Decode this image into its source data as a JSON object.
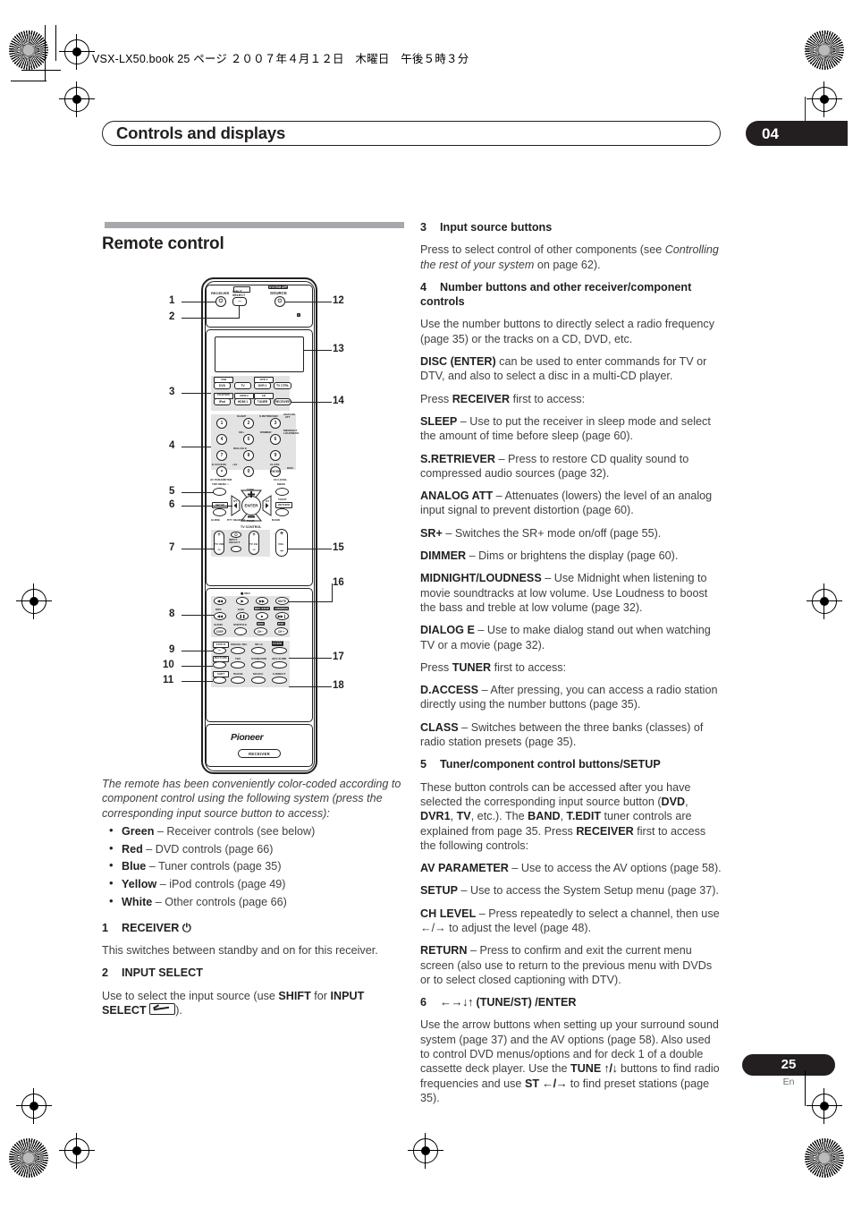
{
  "printmark": {
    "book_line": "VSX-LX50.book  25 ページ  ２００７年４月１２日　木曜日　午後５時３分"
  },
  "header": {
    "chapter_title": "Controls and displays",
    "chapter_number": "04"
  },
  "section": {
    "heading": "Remote control"
  },
  "footer": {
    "page_number": "25",
    "language": "En"
  },
  "left_column": {
    "caption": "The remote has been conveniently color-coded according to component control using the following system (press the corresponding input source button to access):",
    "color_bullets": [
      {
        "color": "Green",
        "text": " – Receiver controls (see below)"
      },
      {
        "color": "Red",
        "text": " – DVD controls (page 66)"
      },
      {
        "color": "Blue",
        "text": " – Tuner controls (page 35)"
      },
      {
        "color": "Yellow",
        "text": " – iPod controls (page 49)"
      },
      {
        "color": "White",
        "text": " – Other controls (page 66)"
      }
    ],
    "item1": {
      "num": "1",
      "title": "RECEIVER",
      "body": "This switches between standby and on for this receiver."
    },
    "item2": {
      "num": "2",
      "title": "INPUT SELECT",
      "body_a": "Use to select the input source (use ",
      "bold_a": "SHIFT",
      "body_b": " for ",
      "bold_b": "INPUT SELECT",
      "body_c": ")."
    }
  },
  "right_column": {
    "item3": {
      "num": "3",
      "title": "Input source buttons",
      "body_a": "Press to select control of other components (see ",
      "italic": "Controlling the rest of your system",
      "body_b": " on page 62)."
    },
    "item4": {
      "num": "4",
      "title": "Number buttons and other receiver/component controls",
      "body": "Use the number buttons to directly select a radio frequency (page 35) or the tracks on a CD, DVD, etc.",
      "disc_bold": "DISC (ENTER)",
      "disc_text": " can be used to enter commands for TV or DTV, and also to select a disc in a multi-CD player.",
      "press_a": "Press ",
      "press_bold": "RECEIVER",
      "press_b": " first to access:",
      "entries": [
        {
          "term": "SLEEP",
          "desc": " – Use to put the receiver in sleep mode and select the amount of time before sleep (page 60)."
        },
        {
          "term": "S.RETRIEVER",
          "desc": " – Press to restore CD quality sound to compressed audio sources (page 32)."
        },
        {
          "term": "ANALOG ATT",
          "desc": " – Attenuates (lowers) the level of an analog input signal to prevent distortion (page 60)."
        },
        {
          "term": "SR+",
          "desc": " – Switches the SR+ mode on/off (page 55)."
        },
        {
          "term": "DIMMER",
          "desc": " – Dims or brightens the display (page 60)."
        },
        {
          "term": "MIDNIGHT/LOUDNESS",
          "desc": " – Use Midnight when listening to movie soundtracks at low volume. Use Loudness to boost the bass and treble at low volume (page 32)."
        },
        {
          "term": "DIALOG E",
          "desc": " – Use to make dialog stand out when watching TV or a movie (page 32)."
        }
      ],
      "press2_a": "Press ",
      "press2_bold": "TUNER",
      "press2_b": " first to access:",
      "entries2": [
        {
          "term": "D.ACCESS",
          "desc": " – After pressing, you can access a radio station directly using the number buttons (page 35)."
        },
        {
          "term": "CLASS",
          "desc": " – Switches between the three banks (classes) of radio station presets (page 35)."
        }
      ]
    },
    "item5": {
      "num": "5",
      "title": "Tuner/component control buttons/SETUP",
      "body_a": "These button controls can be accessed after you have selected the corresponding input source button (",
      "b1": "DVD",
      "body_b": ", ",
      "b2": "DVR1",
      "body_c": ", ",
      "b3": "TV",
      "body_d": ", etc.). The ",
      "b4": "BAND",
      "body_e": ", ",
      "b5": "T.EDIT",
      "body_f": " tuner controls are explained from page 35. Press ",
      "b6": "RECEIVER",
      "body_g": " first to access the following controls:",
      "entries": [
        {
          "term": "AV PARAMETER",
          "desc": " – Use to access the AV options (page 58)."
        },
        {
          "term": "SETUP",
          "desc": " – Use to access the System Setup menu (page 37)."
        },
        {
          "term": "CH LEVEL",
          "desc": " – Press repeatedly to select a channel, then use ←/→ to adjust the level (page 48)."
        },
        {
          "term": "RETURN",
          "desc": " – Press to confirm and exit the current menu screen (also use to return to the previous menu with DVDs or to select closed captioning with DTV)."
        }
      ]
    },
    "item6": {
      "num": "6",
      "title_arrows": "←→↓↑",
      "title_rest": " (TUNE/ST) /ENTER",
      "body_a": "Use the arrow buttons when setting up your surround sound system (page 37) and the AV options (page 58). Also used to control DVD menus/options and for deck 1 of a double cassette deck player. Use the ",
      "b1": "TUNE",
      "b1_arrows": " ↑/↓",
      "body_b": " buttons to find radio frequencies and use ",
      "b2": "ST",
      "b2_arrows": " ←/→",
      "body_c": " to find preset stations (page 35)."
    }
  },
  "remote": {
    "callouts_left": [
      "1",
      "2",
      "3",
      "4",
      "5",
      "6",
      "7",
      "8",
      "9",
      "10",
      "11"
    ],
    "callouts_right": [
      "12",
      "13",
      "14",
      "15",
      "16",
      "17",
      "18"
    ],
    "top_labels": {
      "receiver": "RECEIVER",
      "input_select": "INPUT\nSELECT",
      "system_off": "SYSTEM OFF",
      "source": "SOURCE"
    },
    "source_buttons_row1": [
      "DVD",
      "TV",
      "DVR 1",
      "TV CTRL"
    ],
    "source_buttons_row2": [
      "iPod",
      "HDMI 1",
      "TUNER",
      "RECEIVER"
    ],
    "source_shift_row1": [
      "USB",
      "DVR 2"
    ],
    "source_shift_row2": [
      "CD-R/TAPE",
      "HDMI 2",
      "CD"
    ],
    "numpad": [
      "1",
      "2",
      "3",
      "4",
      "5",
      "6",
      "7",
      "8",
      "9",
      "∙",
      "0",
      "ENTER"
    ],
    "numpad_shift": [
      "SLEEP",
      "S.RETRIEVER",
      "ANALOG ATT",
      "SR+",
      "DIMMER",
      "MIDNIGHT/ LOUDNESS",
      "DIALOG E",
      "D.ACCESS",
      "+10",
      "CLASS",
      "DISC"
    ],
    "nav_labels": {
      "av_parameter": "AV PARAMETER",
      "top_menu": "TOP MENU",
      "ch_level": "CH LEVEL",
      "menu": "MENU",
      "setup": "SETUP",
      "return": "RETURN",
      "guide": "GUIDE",
      "pty_search": "PTY SEARCH",
      "band": "BAND",
      "t_edit": "T.EDIT",
      "enter": "ENTER",
      "tune_up": "TUNE +",
      "tune_dn": "TUNE −",
      "st_l": "ST",
      "st_r": "ST"
    },
    "tv_control": {
      "title": "TV CONTROL",
      "tv_vol": "TV VOL",
      "input_select": "INPUT\nSELECT",
      "tv_ch": "TV CH",
      "vol": "VOL"
    },
    "transport": {
      "rec": "● REC",
      "mute": "MUTE",
      "mpx": "MPX",
      "eon": "EON",
      "rec_stop": "REC STOP",
      "jukebox": "JUKEBOX",
      "audio": "AUDIO",
      "subtitle": "SUBTITLE",
      "hdd": "HDD",
      "dvd": "DVD",
      "disp": "DISP",
      "ch_minus": "CH −",
      "ch_plus": "CH +"
    },
    "bottom": {
      "status": "STATUS",
      "signal_sel": "SIGNAL SEL",
      "sb_ch": "SB ch",
      "stereo": "STEREO/ F.S.SUR",
      "multi_opt": "MULTI OPE",
      "thx": "THX",
      "standard": "STANDARD",
      "adv_surr": "ADV SURR",
      "shift": "SHIFT",
      "phase": "PHASE",
      "mcacc": "MCACC",
      "s_direct": "S.DIRECT"
    },
    "brand": "Pioneer",
    "bottom_badge": "RECEIVER"
  }
}
